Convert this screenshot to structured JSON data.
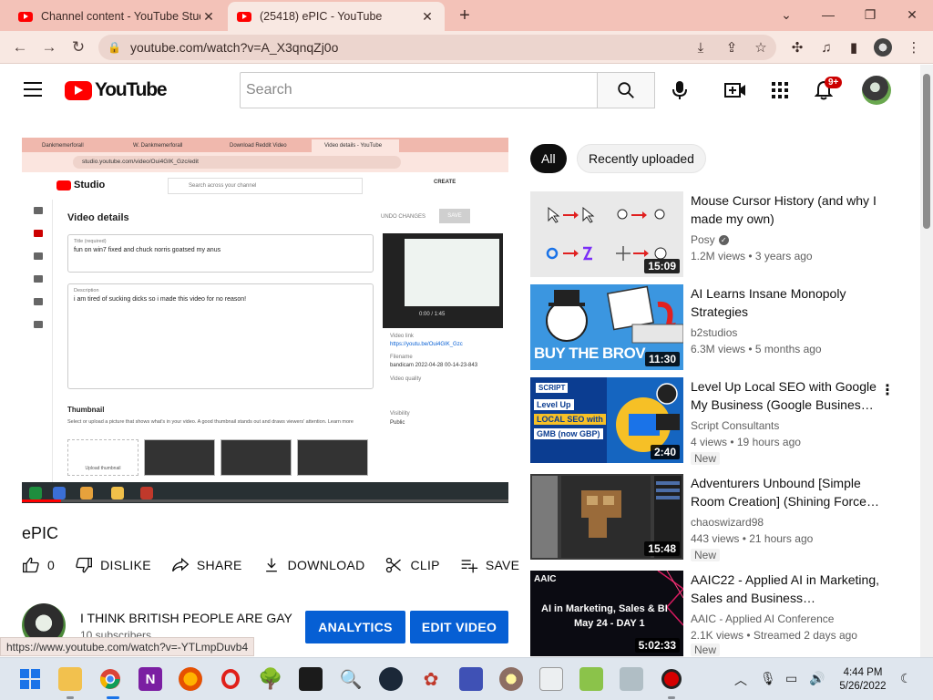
{
  "browser": {
    "tabs": [
      {
        "title": "Channel content - YouTube Stud",
        "active": false
      },
      {
        "title": "(25418) ePIC - YouTube",
        "active": true
      }
    ],
    "url": "youtube.com/watch?v=A_X3qnqZj0o",
    "status_url": "https://www.youtube.com/watch?v=-YTLmpDuvb4"
  },
  "header": {
    "logo_text": "YouTube",
    "search_placeholder": "Search",
    "notification_count": "9+"
  },
  "player": {
    "embedded_tabs": [
      "Dankmemerforall",
      "W. Dankmemerforall",
      "Download Reddit Video",
      "Video details - YouTube"
    ],
    "embedded_url": "studio.youtube.com/video/Oui4GIK_Gzc/edit",
    "studio_logo": "Studio",
    "studio_search": "Search across your channel",
    "create_label": "CREATE",
    "video_details": "Video details",
    "undo_label": "UNDO CHANGES",
    "save_label": "SAVE",
    "title_label": "Title (required)",
    "title_value": "fun on win7 fixed and chuck norris goatsed my anus",
    "desc_label": "Description",
    "desc_value": "i am tired of sucking dicks so i made this video for no reason!",
    "video_link_label": "Video link",
    "video_link": "https://youtu.be/Oui4GIK_Gzc",
    "filename_label": "Filename",
    "filename": "bandicam 2022-04-28 00-14-23-843",
    "quality_label": "Video quality",
    "visibility_label": "Visibility",
    "visibility": "Public",
    "thumbnail_heading": "Thumbnail",
    "thumbnail_text": "Select or upload a picture that shows what's in your video. A good thumbnail stands out and draws viewers' attention. Learn more",
    "upload_thumb": "Upload thumbnail",
    "time_readout": "0:00 / 1:45",
    "progress": 0.08
  },
  "video": {
    "title": "ePIC",
    "actions": [
      {
        "label": "0",
        "icon": "thumbs-up-icon"
      },
      {
        "label": "DISLIKE",
        "icon": "thumbs-down-icon"
      },
      {
        "label": "SHARE",
        "icon": "share-icon"
      },
      {
        "label": "DOWNLOAD",
        "icon": "download-icon"
      },
      {
        "label": "CLIP",
        "icon": "scissors-icon"
      },
      {
        "label": "SAVE",
        "icon": "playlist-add-icon"
      }
    ],
    "channel_name": "I THINK BRITISH PEOPLE ARE GAY",
    "subscribers": "10 subscribers",
    "analytics_label": "ANALYTICS",
    "edit_label": "EDIT VIDEO"
  },
  "chips": [
    "All",
    "Recently uploaded"
  ],
  "recommendations": [
    {
      "title": "Mouse Cursor History (and why I made my own)",
      "channel": "Posy",
      "verified": true,
      "meta": "1.2M views • 3 years ago",
      "duration": "15:09",
      "badge": ""
    },
    {
      "title": "AI Learns Insane Monopoly Strategies",
      "channel": "b2studios",
      "verified": false,
      "meta": "6.3M views • 5 months ago",
      "duration": "11:30",
      "badge": ""
    },
    {
      "title": "Level Up Local SEO with Google My Business (Google Busines…",
      "channel": "Script Consultants",
      "verified": false,
      "meta": "4 views • 19 hours ago",
      "duration": "2:40",
      "badge": "New"
    },
    {
      "title": "Adventurers Unbound [Simple Room Creation] (Shining Force…",
      "channel": "chaoswizard98",
      "verified": false,
      "meta": "443 views • 21 hours ago",
      "duration": "15:48",
      "badge": "New"
    },
    {
      "title": "AAIC22 - Applied AI in Marketing, Sales and Business…",
      "channel": "AAIC - Applied AI Conference",
      "verified": false,
      "meta": "2.1K views • Streamed 2 days ago",
      "duration": "5:02:33",
      "badge": "New"
    }
  ],
  "thumb_text": {
    "monopoly_caption": "BUY THE BROV",
    "seo_tag": "SCRIPT",
    "seo_line1": "Level Up",
    "seo_line2": "LOCAL SEO with",
    "seo_line3": "GMB (now GBP)",
    "aaic_logo": "AAIC",
    "aaic_line1": "AI in Marketing, Sales & BI",
    "aaic_line2": "May 24 - DAY 1"
  },
  "taskbar": {
    "time": "4:44 PM",
    "date": "5/26/2022"
  },
  "colors": {
    "tab_strip": "#f3c2b8",
    "yt_red": "#ff0000",
    "cta_blue": "#065fd4",
    "chip_selected": "#0f0f0f"
  }
}
